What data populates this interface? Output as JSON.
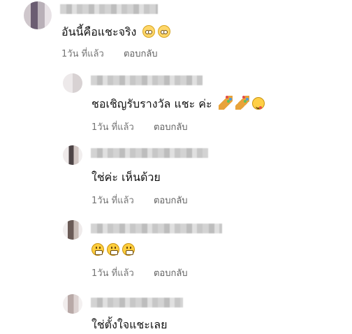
{
  "comments": [
    {
      "text": "อันนี้คือแชะจริง",
      "time": "1วัน ที่แล้ว",
      "reply": "ตอบกลับ",
      "emojis": [
        "flushed-face-icon",
        "flushed-face-icon"
      ]
    },
    {
      "text": "ชอเชิญรับรางวัล แชะ ค่ะ",
      "time": "1วัน ที่แล้ว",
      "reply": "ตอบกลับ",
      "emojis": [
        "party-popper-icon",
        "party-popper-icon",
        "yum-face-icon"
      ]
    },
    {
      "text": "ใช่ค่ะ เห็นด้วย",
      "time": "1วัน ที่แล้ว",
      "reply": "ตอบกลับ",
      "emojis": []
    },
    {
      "text": "",
      "time": "1วัน ที่แล้ว",
      "reply": "ตอบกลับ",
      "emojis": [
        "grimacing-face-icon",
        "grimacing-face-icon",
        "grimacing-face-icon"
      ]
    },
    {
      "text": "ใช่ตั้งใจแชะเลย",
      "time": "",
      "reply": "",
      "emojis": []
    }
  ],
  "colors": {
    "text": "#111111",
    "meta": "#757575",
    "background": "#ffffff"
  }
}
